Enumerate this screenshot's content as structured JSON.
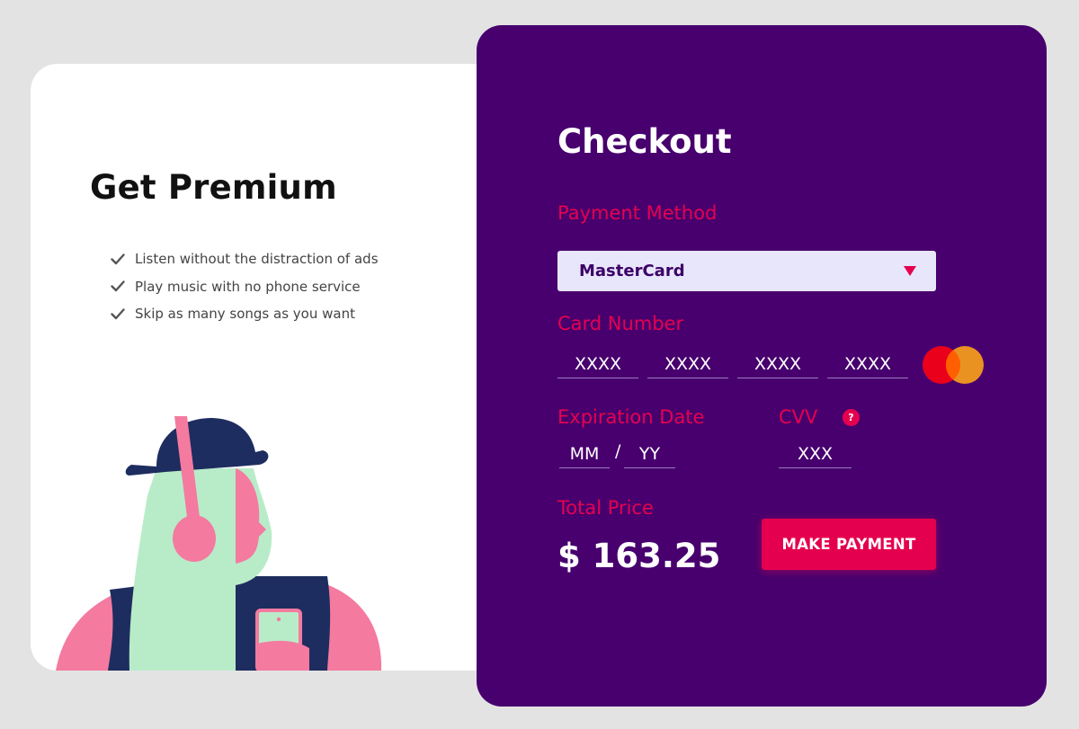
{
  "premium": {
    "title": "Get Premium",
    "benefits": [
      "Listen without the distraction of ads",
      "Play music with no phone service",
      "Skip as many songs as you want"
    ]
  },
  "checkout": {
    "title": "Checkout",
    "payment_method_label": "Payment Method",
    "payment_method_value": "MasterCard",
    "card_number_label": "Card Number",
    "card_number_placeholders": [
      "XXXX",
      "XXXX",
      "XXXX",
      "XXXX"
    ],
    "expiration_label": "Expiration Date",
    "month_placeholder": "MM",
    "date_separator": "/",
    "year_placeholder": "YY",
    "cvv_label": "CVV",
    "cvv_help_icon": "?",
    "cvv_placeholder": "XXX",
    "total_label": "Total Price",
    "total_value": "$ 163.25",
    "pay_button_label": "MAKE PAYMENT"
  },
  "colors": {
    "page_bg": "#e3e3e3",
    "card_purple": "#47006e",
    "accent_pink": "#e5004f",
    "select_bg": "#e8e6fb"
  },
  "icons": {
    "benefit_icon": "check-icon",
    "select_icon": "caret-down-icon",
    "card_brand_icon": "mastercard-icon",
    "help_icon": "help-icon"
  }
}
